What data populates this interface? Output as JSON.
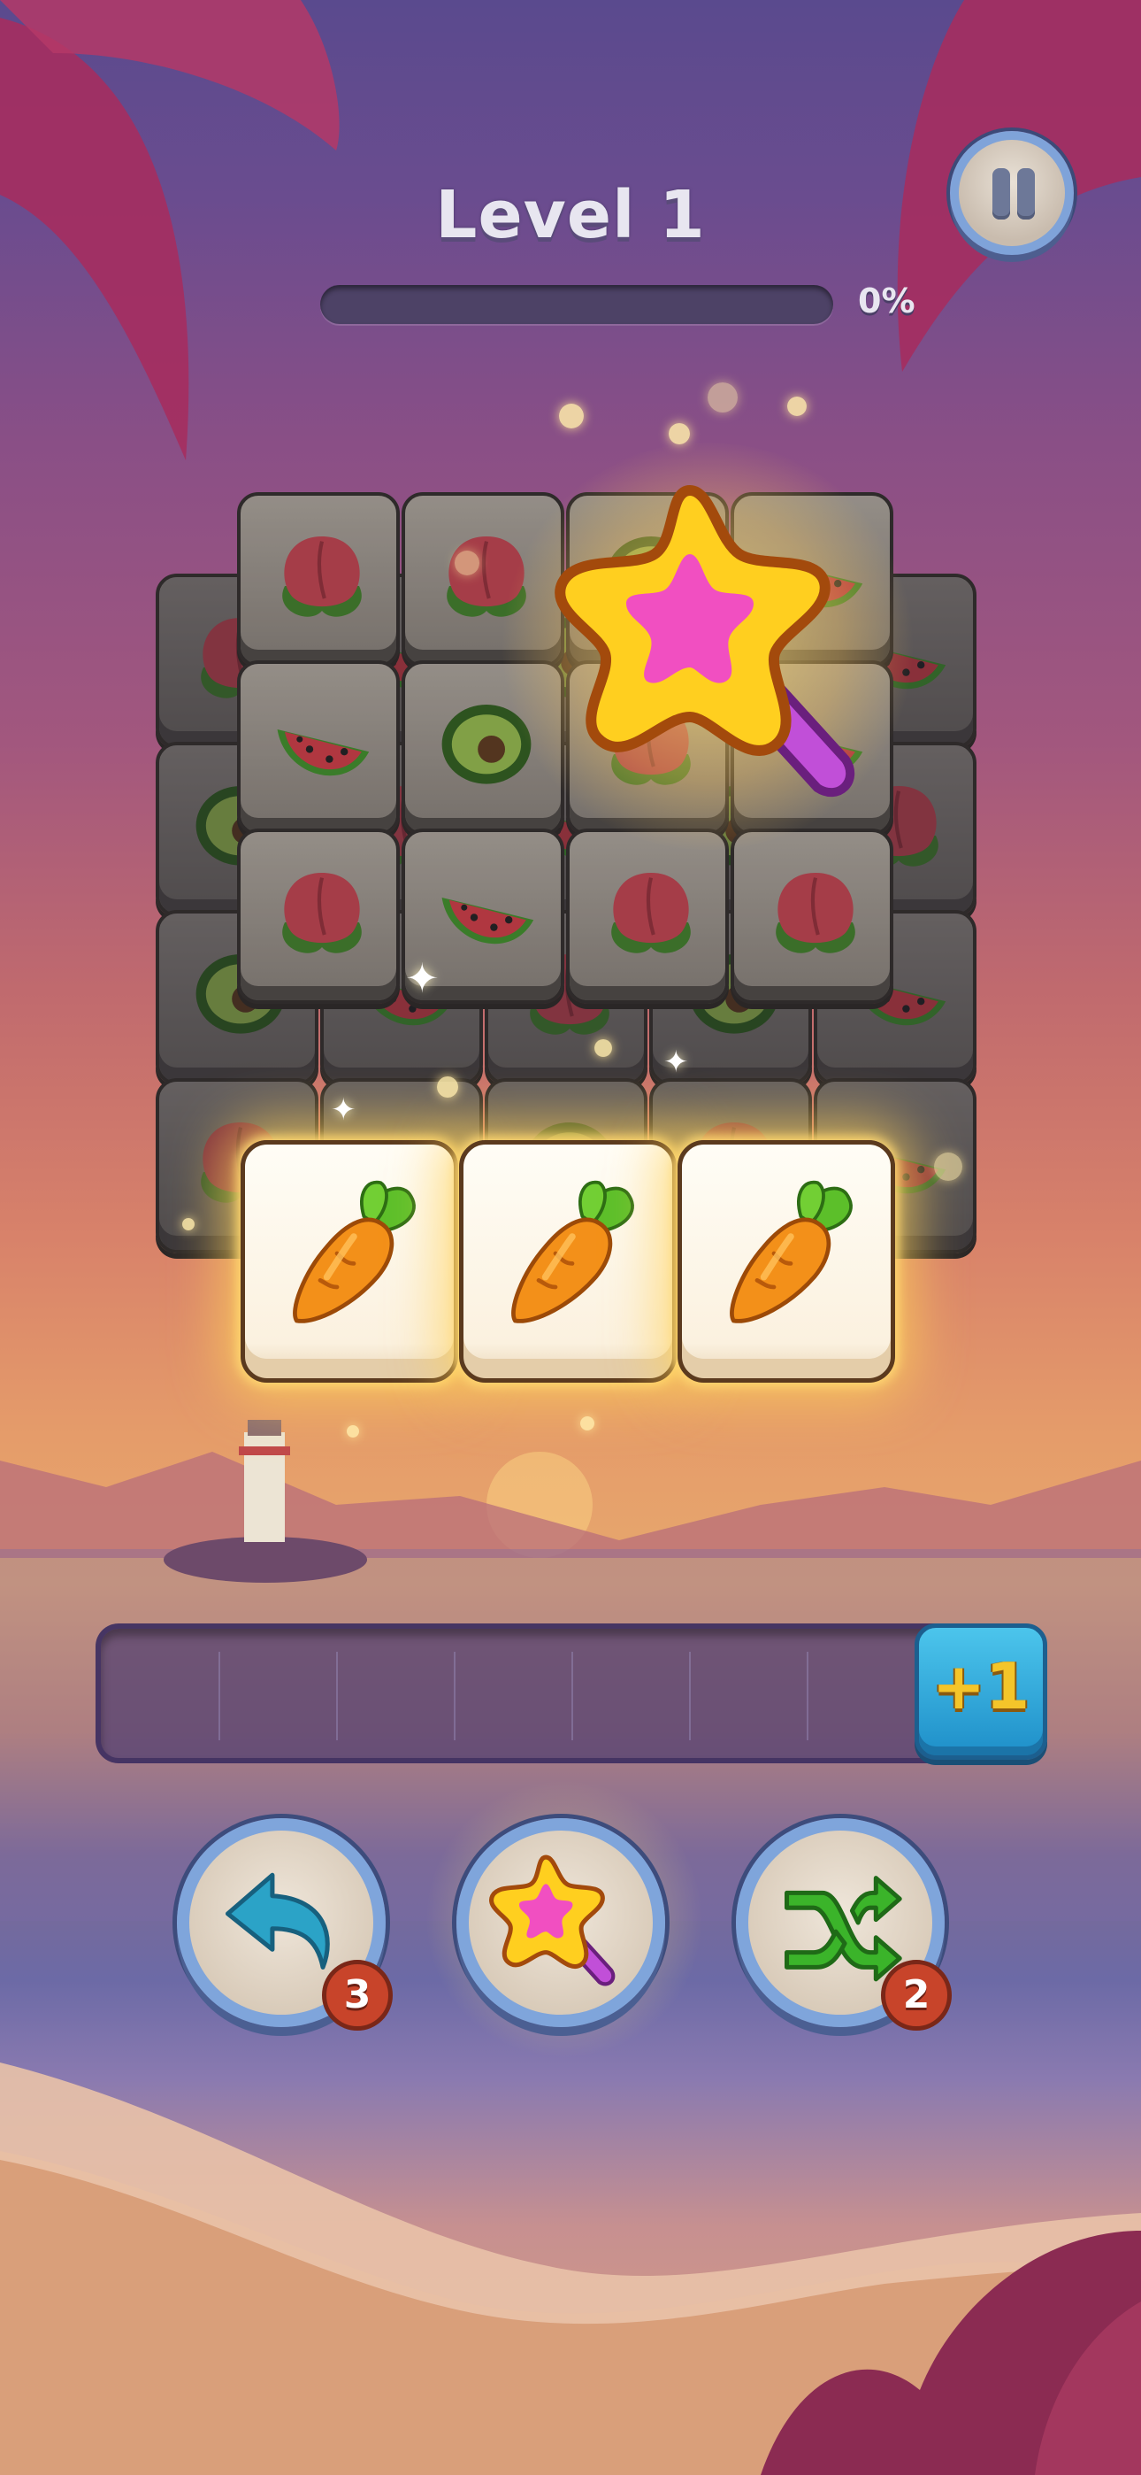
{
  "header": {
    "level_title": "Level 1",
    "progress_text": "0%",
    "progress_fraction": 0.0
  },
  "board": {
    "highlighted_tiles": [
      "carrot",
      "carrot",
      "carrot"
    ],
    "active_booster_icon": "magic-wand-icon"
  },
  "tray": {
    "slot_count": 8,
    "extra_slot_label": "+1"
  },
  "boosters": [
    {
      "name": "undo",
      "icon": "undo-arrow-icon",
      "count": "3"
    },
    {
      "name": "magic-wand",
      "icon": "magic-wand-icon",
      "count": ""
    },
    {
      "name": "shuffle",
      "icon": "shuffle-icon",
      "count": "2"
    }
  ],
  "colors": {
    "undo_arrow": "#2ba3c7",
    "shuffle_arrows": "#3bb42a",
    "wand_star": "#ffcf1f",
    "wand_center": "#f14fc1",
    "badge": "#c8442a"
  }
}
